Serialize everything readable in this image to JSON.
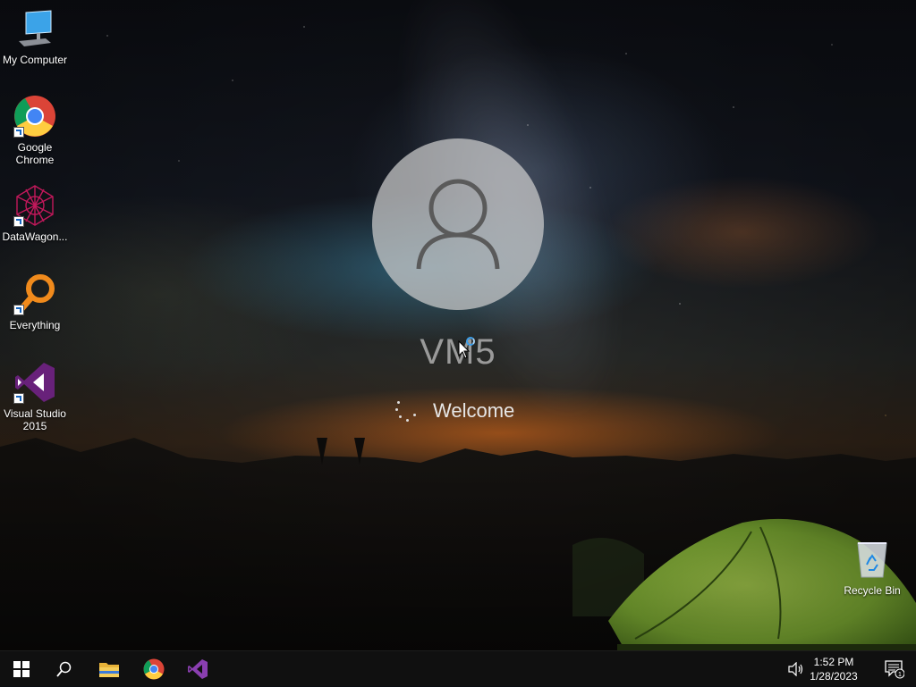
{
  "desktop": {
    "icons": [
      {
        "label": "My Computer",
        "icon": "computer-icon"
      },
      {
        "label": "Google\nChrome",
        "icon": "chrome-icon"
      },
      {
        "label": "DataWagon...",
        "icon": "datawagon-icon"
      },
      {
        "label": "Everything",
        "icon": "everything-search-icon"
      },
      {
        "label": "Visual Studio\n2015",
        "icon": "visual-studio-icon"
      },
      {
        "label": "Recycle Bin",
        "icon": "recycle-bin-icon"
      }
    ]
  },
  "login": {
    "username": "VM5",
    "status": "Welcome"
  },
  "taskbar": {
    "pinned": [
      "windows-start-icon",
      "search-icon",
      "file-explorer-icon",
      "chrome-icon",
      "visual-studio-icon"
    ],
    "tray": {
      "time": "1:52 PM",
      "date": "1/28/2023",
      "notification_count": "1"
    }
  },
  "colors": {
    "taskbar": "#101010",
    "accent": "#3b9de8",
    "tent": "#8fc43a"
  }
}
